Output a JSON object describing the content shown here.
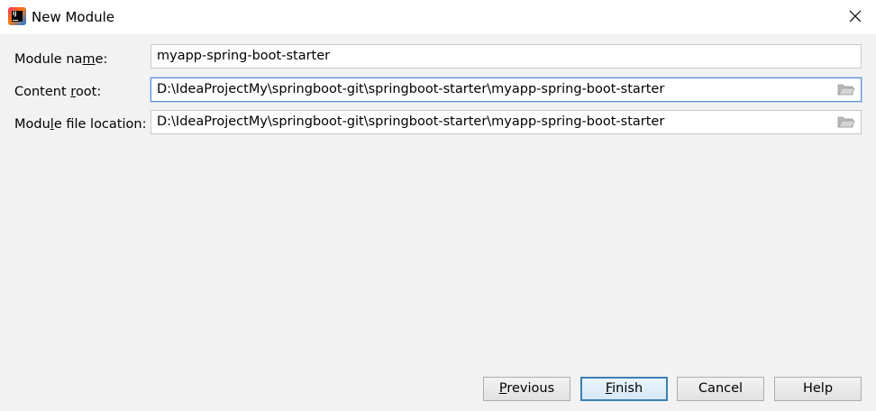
{
  "window": {
    "title": "New Module",
    "app_icon": "intellij-idea-icon",
    "close_icon": "close-icon"
  },
  "form": {
    "module_name": {
      "label_pre": "Module na",
      "label_mnemonic": "m",
      "label_post": "e:",
      "value": "myapp-spring-boot-starter"
    },
    "content_root": {
      "label_pre": "Content ",
      "label_mnemonic": "r",
      "label_post": "oot:",
      "value": "D:\\IdeaProjectMy\\springboot-git\\springboot-starter\\myapp-spring-boot-starter",
      "browse_icon": "folder-icon"
    },
    "module_file_location": {
      "label_pre": "Modu",
      "label_mnemonic": "l",
      "label_post": "e file location:",
      "value": "D:\\IdeaProjectMy\\springboot-git\\springboot-starter\\myapp-spring-boot-starter",
      "browse_icon": "folder-icon"
    }
  },
  "buttons": {
    "previous": {
      "mnemonic": "P",
      "rest": "revious"
    },
    "finish": {
      "mnemonic": "F",
      "rest": "inish"
    },
    "cancel": {
      "label": "Cancel"
    },
    "help": {
      "label": "Help"
    }
  },
  "colors": {
    "dialog_background": "#f2f2f2",
    "focus_border": "#5a8ddb",
    "default_button_border": "#3c7fb1"
  }
}
